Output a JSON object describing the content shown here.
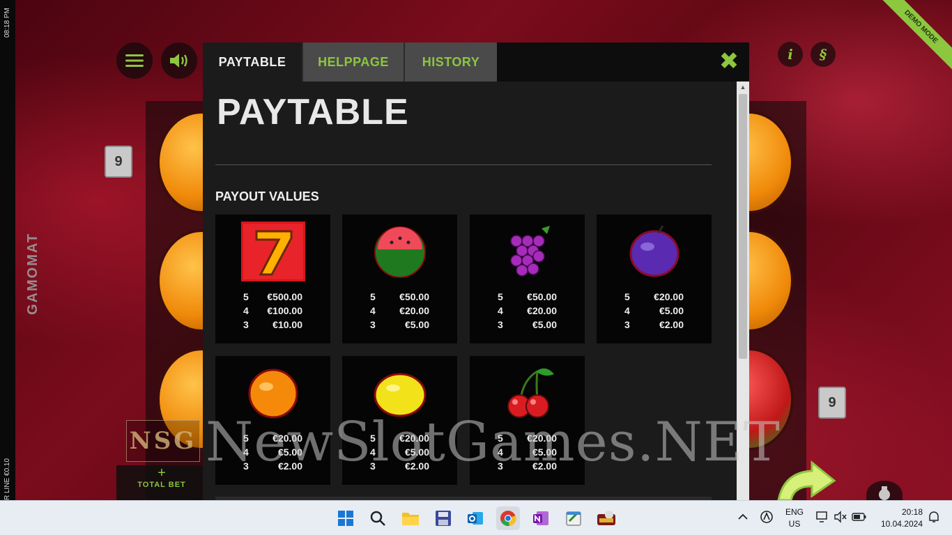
{
  "game": {
    "clock_vertical": "08:18 PM",
    "line_vertical": "R LINE €0.10",
    "brand": "GAMOMAT",
    "demo_ribbon": "DEMO MODE",
    "line_badge_left": "9",
    "line_badge_right": "9",
    "total_bet_plus": "+",
    "total_bet_label": "TOTAL BET",
    "info_icon": "i",
    "currency_icon": "§"
  },
  "modal": {
    "tabs": [
      {
        "label": "PAYTABLE",
        "active": true
      },
      {
        "label": "HELPPAGE",
        "active": false
      },
      {
        "label": "HISTORY",
        "active": false
      }
    ],
    "close_glyph": "✖",
    "title": "PAYTABLE",
    "section_title": "PAYOUT VALUES",
    "symbols": [
      {
        "name": "seven",
        "icon": "seven-icon",
        "pays": [
          {
            "count": "5",
            "amount": "€500.00"
          },
          {
            "count": "4",
            "amount": "€100.00"
          },
          {
            "count": "3",
            "amount": "€10.00"
          }
        ]
      },
      {
        "name": "watermelon",
        "icon": "watermelon-icon",
        "pays": [
          {
            "count": "5",
            "amount": "€50.00"
          },
          {
            "count": "4",
            "amount": "€20.00"
          },
          {
            "count": "3",
            "amount": "€5.00"
          }
        ]
      },
      {
        "name": "grapes",
        "icon": "grapes-icon",
        "pays": [
          {
            "count": "5",
            "amount": "€50.00"
          },
          {
            "count": "4",
            "amount": "€20.00"
          },
          {
            "count": "3",
            "amount": "€5.00"
          }
        ]
      },
      {
        "name": "plum",
        "icon": "plum-icon",
        "pays": [
          {
            "count": "5",
            "amount": "€20.00"
          },
          {
            "count": "4",
            "amount": "€5.00"
          },
          {
            "count": "3",
            "amount": "€2.00"
          }
        ]
      },
      {
        "name": "orange",
        "icon": "orange-icon",
        "pays": [
          {
            "count": "5",
            "amount": "€20.00"
          },
          {
            "count": "4",
            "amount": "€5.00"
          },
          {
            "count": "3",
            "amount": "€2.00"
          }
        ]
      },
      {
        "name": "lemon",
        "icon": "lemon-icon",
        "pays": [
          {
            "count": "5",
            "amount": "€20.00"
          },
          {
            "count": "4",
            "amount": "€5.00"
          },
          {
            "count": "3",
            "amount": "€2.00"
          }
        ]
      },
      {
        "name": "cherries",
        "icon": "cherries-icon",
        "pays": [
          {
            "count": "5",
            "amount": "€20.00"
          },
          {
            "count": "4",
            "amount": "€5.00"
          },
          {
            "count": "3",
            "amount": "€2.00"
          }
        ]
      }
    ]
  },
  "watermark": {
    "text": "NewSlotGames.NET",
    "logo": "NSG"
  },
  "taskbar": {
    "apps": [
      "windows-start-icon",
      "search-icon",
      "file-explorer-icon",
      "save-icon",
      "outlook-icon",
      "chrome-icon",
      "onenote-icon",
      "notepad-icon",
      "slot-game-icon"
    ],
    "tray": {
      "lang_top": "ENG",
      "lang_bottom": "US",
      "time": "20:18",
      "date": "10.04.2024"
    }
  },
  "colors": {
    "accent": "#8dc63f",
    "modal_bg": "#1b1b1b",
    "card_bg": "#050505"
  }
}
